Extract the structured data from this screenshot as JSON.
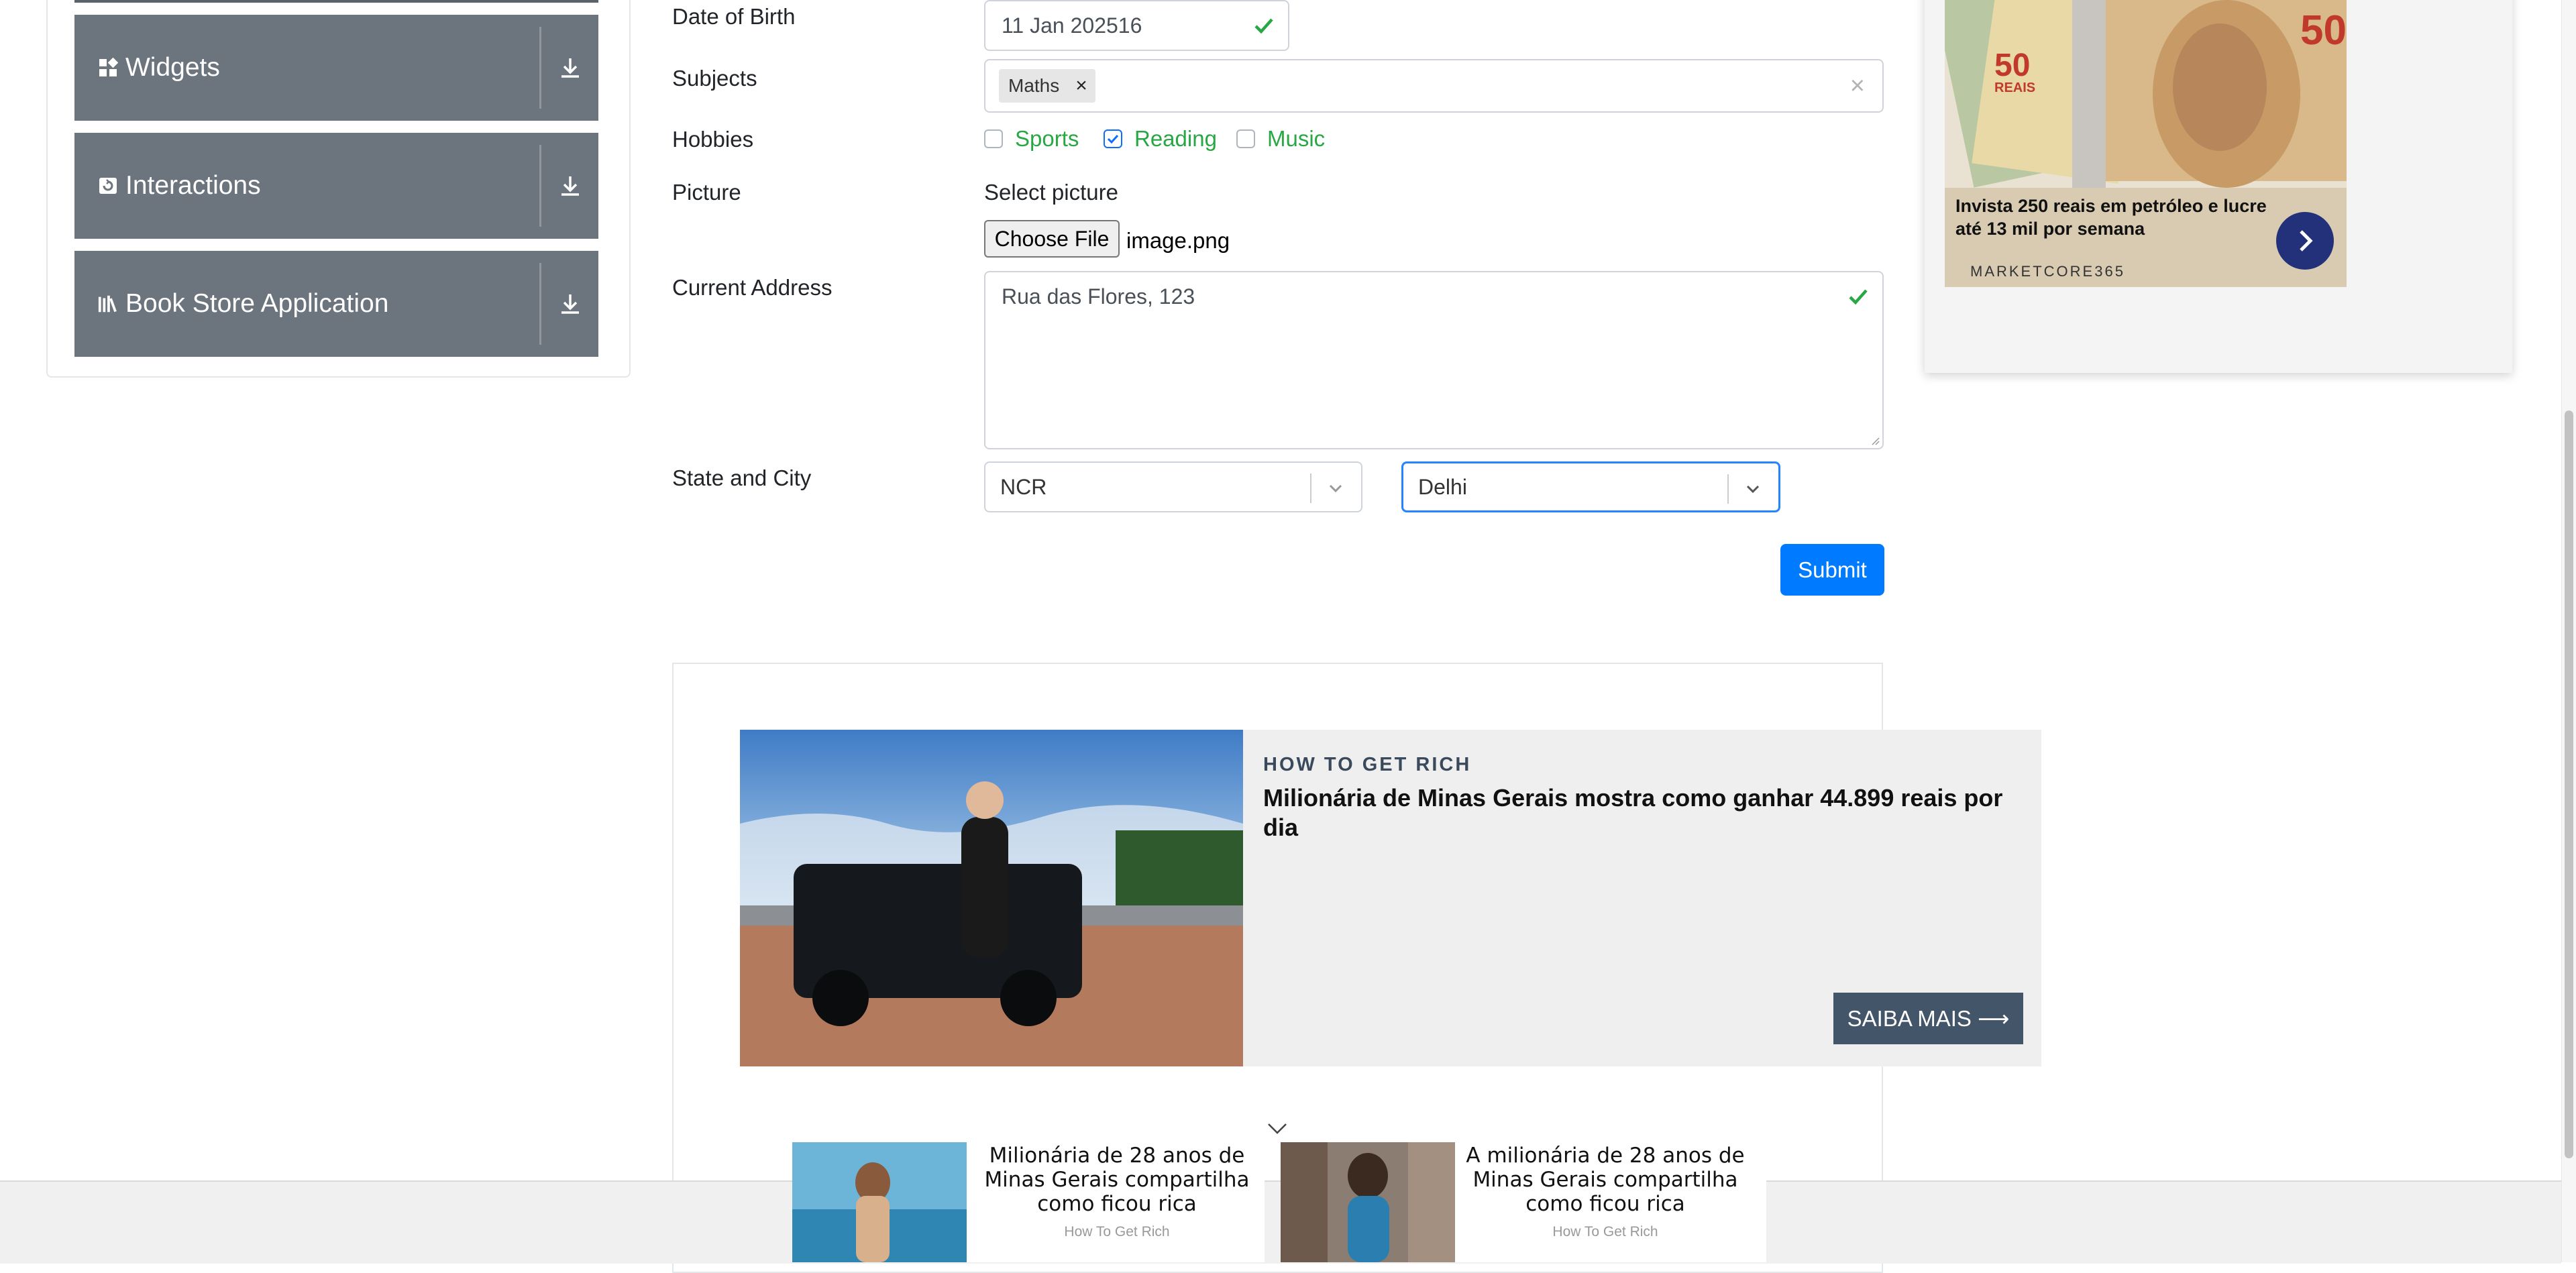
{
  "sidebar": {
    "groups": [
      {
        "label": "Widgets",
        "icon": "widgets-icon"
      },
      {
        "label": "Interactions",
        "icon": "interactions-icon"
      },
      {
        "label": "Book Store Application",
        "icon": "book-store-icon"
      }
    ]
  },
  "form": {
    "dob": {
      "label": "Date of Birth",
      "value": "11 Jan 202516"
    },
    "subjects": {
      "label": "Subjects",
      "chips": [
        "Maths"
      ]
    },
    "hobbies": {
      "label": "Hobbies",
      "options": [
        {
          "label": "Sports",
          "checked": false
        },
        {
          "label": "Reading",
          "checked": true
        },
        {
          "label": "Music",
          "checked": false
        }
      ]
    },
    "picture": {
      "label": "Picture",
      "prompt": "Select picture",
      "button": "Choose File",
      "filename": "image.png"
    },
    "address": {
      "label": "Current Address",
      "value": "Rua das Flores, 123"
    },
    "state_city": {
      "label": "State and City",
      "state": "NCR",
      "city": "Delhi"
    },
    "submit": "Submit"
  },
  "ad_right": {
    "text": "Invista 250 reais em petróleo e lucre até 13 mil por semana",
    "brand": "MARKETCORE365",
    "note_value": "50",
    "note_currency": "REAIS"
  },
  "content_ad": {
    "kicker": "HOW TO GET RICH",
    "headline": "Milionária de Minas Gerais mostra como ganhar 44.899 reais por dia",
    "cta": "SAIBA MAIS ⟶"
  },
  "bottom_ads": [
    {
      "title": "Milionária de 28 anos de Minas Gerais compartilha como ficou rica",
      "source": "How To Get Rich"
    },
    {
      "title": "A milionária de 28 anos de Minas Gerais compartilha como ficou rica",
      "source": "How To Get Rich"
    }
  ],
  "colors": {
    "accent": "#007bff",
    "success": "#28a745",
    "sidebar": "#6c757d",
    "cta": "#425569"
  }
}
